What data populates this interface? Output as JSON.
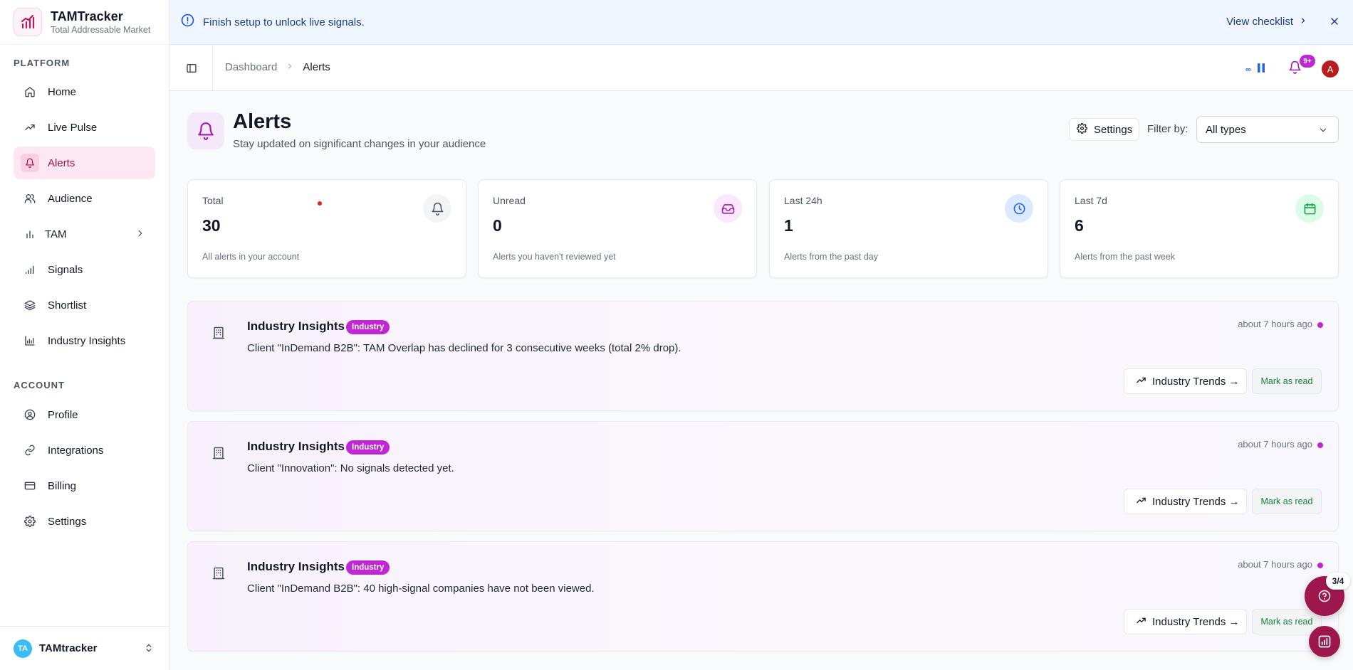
{
  "brand": {
    "name": "TAMTracker",
    "subtitle": "Total Addressable Market"
  },
  "sidebar": {
    "platform_label": "PLATFORM",
    "platform_items": [
      {
        "label": "Home",
        "icon": "home-icon"
      },
      {
        "label": "Live Pulse",
        "icon": "trending-up-icon"
      },
      {
        "label": "Alerts",
        "icon": "bell-icon",
        "active": true
      },
      {
        "label": "Audience",
        "icon": "users-icon"
      },
      {
        "label": "TAM",
        "icon": "bar-chart-icon",
        "has_submenu": true
      },
      {
        "label": "Signals",
        "icon": "signal-icon"
      },
      {
        "label": "Shortlist",
        "icon": "layers-icon"
      },
      {
        "label": "Industry Insights",
        "icon": "chart-icon"
      }
    ],
    "account_label": "ACCOUNT",
    "account_items": [
      {
        "label": "Profile",
        "icon": "user-circle-icon"
      },
      {
        "label": "Integrations",
        "icon": "link-icon"
      },
      {
        "label": "Billing",
        "icon": "credit-card-icon"
      },
      {
        "label": "Settings",
        "icon": "gear-icon"
      }
    ],
    "team": {
      "initials": "TA",
      "name": "TAMtracker"
    }
  },
  "banner": {
    "message": "Finish setup to unlock live signals.",
    "link": "View checklist"
  },
  "breadcrumb": {
    "parent": "Dashboard",
    "current": "Alerts"
  },
  "topbar": {
    "live_count": "∞",
    "notification_badge": "9+",
    "user_initial": "A"
  },
  "page": {
    "title": "Alerts",
    "subtitle": "Stay updated on significant changes in your audience",
    "settings_label": "Settings",
    "filter_label": "Filter by:",
    "filter_value": "All types"
  },
  "stats": [
    {
      "label": "Total",
      "value": "30",
      "desc": "All alerts in your account",
      "icon": "bell-icon",
      "color": "#4b5563",
      "bg": "#f3f4f6"
    },
    {
      "label": "Unread",
      "value": "0",
      "desc": "Alerts you haven't reviewed yet",
      "icon": "inbox-icon",
      "color": "#a21caf",
      "bg": "#fae8ff"
    },
    {
      "label": "Last 24h",
      "value": "1",
      "desc": "Alerts from the past day",
      "icon": "clock-icon",
      "color": "#2563eb",
      "bg": "#dbeafe"
    },
    {
      "label": "Last 7d",
      "value": "6",
      "desc": "Alerts from the past week",
      "icon": "calendar-icon",
      "color": "#16a34a",
      "bg": "#dcfce7"
    }
  ],
  "alerts": [
    {
      "title": "Industry Insights",
      "badge": "Industry",
      "message": "Client \"InDemand B2B\": TAM Overlap has declined for 3 consecutive weeks (total 2% drop).",
      "time": "about 7 hours ago",
      "action": "Industry Trends →",
      "mark": "Mark as read"
    },
    {
      "title": "Industry Insights",
      "badge": "Industry",
      "message": "Client \"Innovation\": No signals detected yet.",
      "time": "about 7 hours ago",
      "action": "Industry Trends →",
      "mark": "Mark as read"
    },
    {
      "title": "Industry Insights",
      "badge": "Industry",
      "message": "Client \"InDemand B2B\": 40 high-signal companies have not been viewed.",
      "time": "about 7 hours ago",
      "action": "Industry Trends →",
      "mark": "Mark as read"
    }
  ],
  "help": {
    "progress": "3/4"
  },
  "colors": {
    "accent": "#9d174d",
    "badge": "#c026d3",
    "banner_bg": "#eff6ff"
  }
}
